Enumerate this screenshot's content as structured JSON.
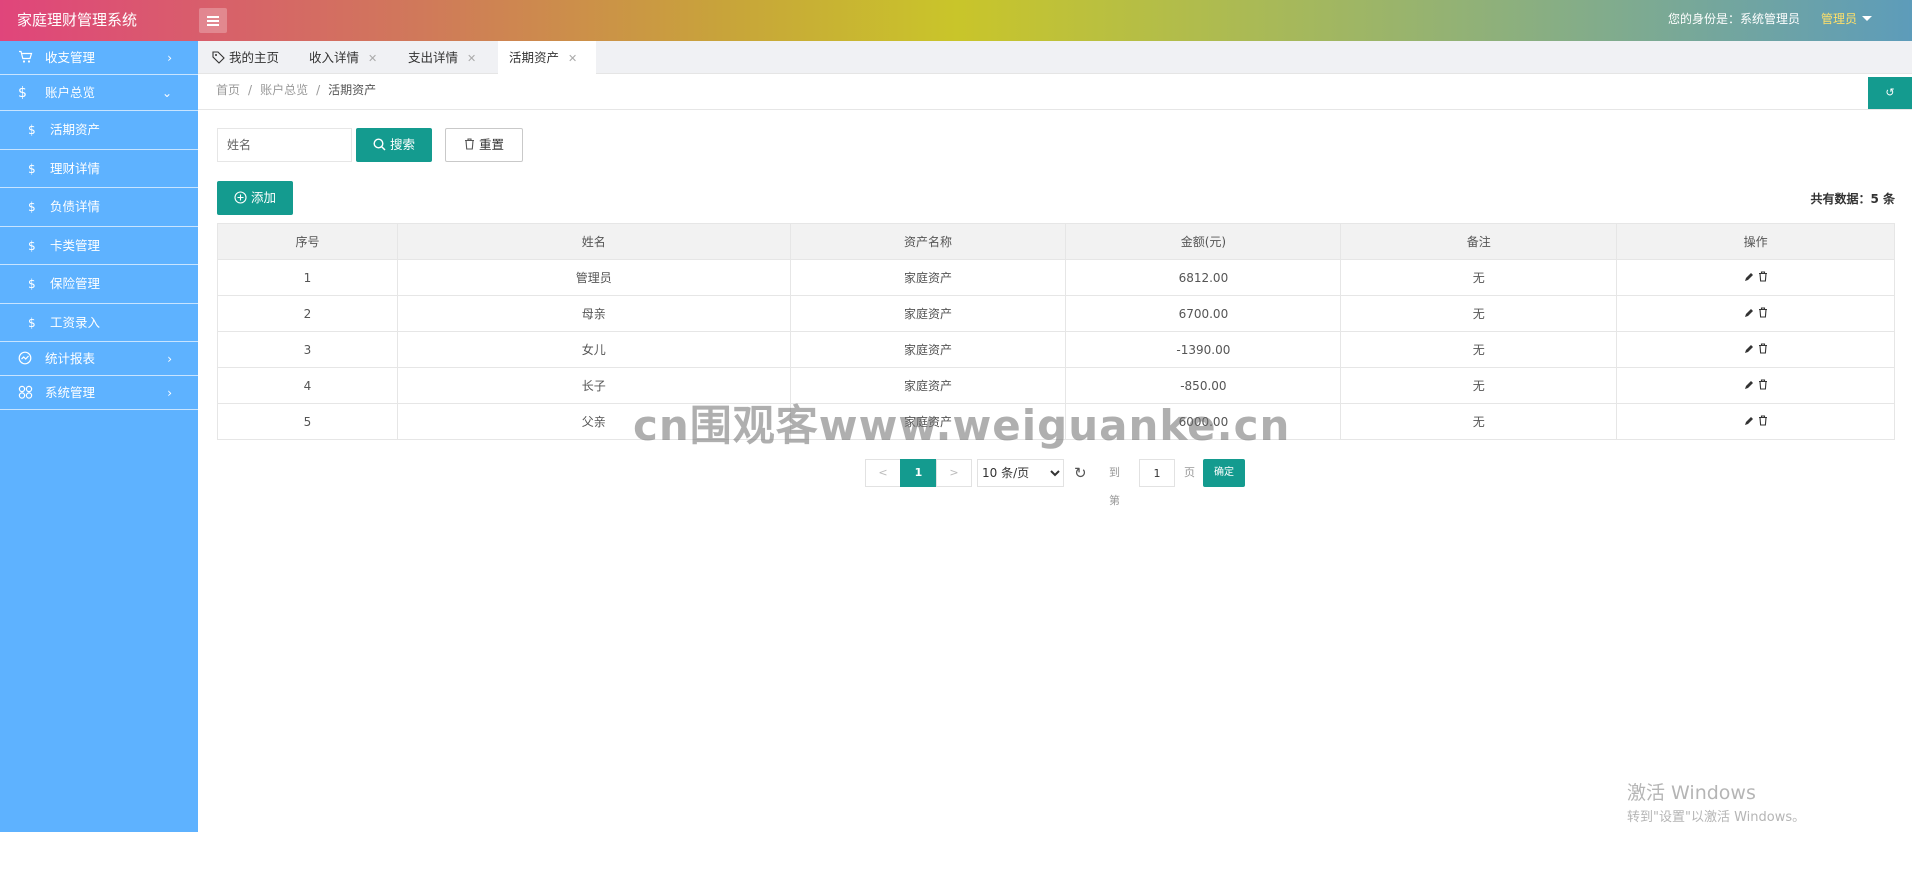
{
  "header": {
    "brand": "家庭理财管理系统",
    "identity": "您的身份是：系统管理员",
    "user": "管理员"
  },
  "sidebar": {
    "items": [
      {
        "icon": "cart-icon",
        "label": "收支管理"
      },
      {
        "icon": "dollar-icon",
        "label": "账户总览"
      },
      {
        "icon": "dollar-icon",
        "label": "活期资产"
      },
      {
        "icon": "dollar-icon",
        "label": "理财详情"
      },
      {
        "icon": "dollar-icon",
        "label": "负债详情"
      },
      {
        "icon": "dollar-icon",
        "label": "卡类管理"
      },
      {
        "icon": "dollar-icon",
        "label": "保险管理"
      },
      {
        "icon": "dollar-icon",
        "label": "工资录入"
      },
      {
        "icon": "chart-icon",
        "label": "统计报表"
      },
      {
        "icon": "grid-icon",
        "label": "系统管理"
      }
    ]
  },
  "tabs": [
    {
      "label": "我的主页"
    },
    {
      "label": "收入详情"
    },
    {
      "label": "支出详情"
    },
    {
      "label": "活期资产"
    }
  ],
  "breadcrumb": [
    "首页",
    "账户总览",
    "活期资产"
  ],
  "search": {
    "placeholder": "姓名",
    "search_label": "搜索",
    "reset_label": "重置"
  },
  "toolbar": {
    "add_label": "添加",
    "total": "共有数据：5 条"
  },
  "table": {
    "columns": [
      "序号",
      "姓名",
      "资产名称",
      "金额(元)",
      "备注",
      "操作"
    ],
    "rows": [
      [
        "1",
        "管理员",
        "家庭资产",
        "6812.00",
        "无"
      ],
      [
        "2",
        "母亲",
        "家庭资产",
        "6700.00",
        "无"
      ],
      [
        "3",
        "女儿",
        "家庭资产",
        "-1390.00",
        "无"
      ],
      [
        "4",
        "长子",
        "家庭资产",
        "-850.00",
        "无"
      ],
      [
        "5",
        "父亲",
        "家庭资产",
        "6000.00",
        "无"
      ]
    ]
  },
  "pager": {
    "prev": "<",
    "current": "1",
    "next": ">",
    "page_size": "10 条/页",
    "goto_label": "到第",
    "goto_value": "1",
    "page_unit": "页",
    "confirm": "确定"
  },
  "overlays": {
    "watermark": "cn围观客www.weiguanke.cn",
    "activate_title": "激活 Windows",
    "activate_sub": "转到\"设置\"以激活 Windows。"
  },
  "colors": {
    "accent": "#149b8f",
    "sidebar": "#5eb2ff",
    "admin_name": "#ffe06a"
  }
}
